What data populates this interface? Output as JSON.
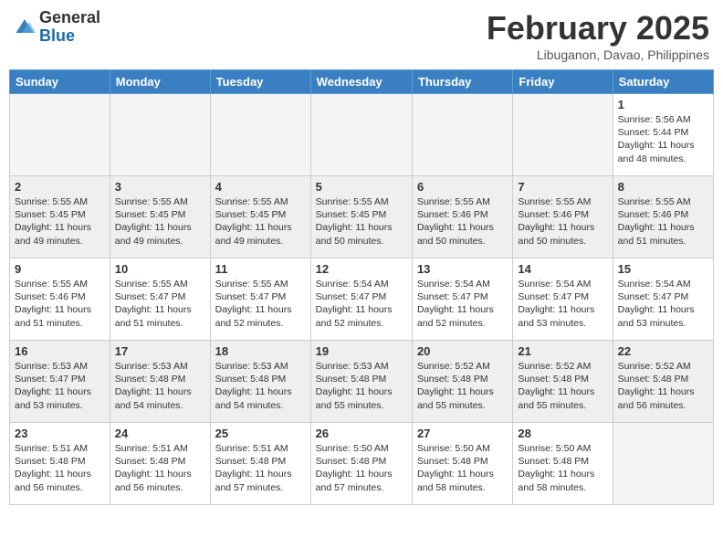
{
  "header": {
    "logo_general": "General",
    "logo_blue": "Blue",
    "month_title": "February 2025",
    "location": "Libuganon, Davao, Philippines"
  },
  "days_of_week": [
    "Sunday",
    "Monday",
    "Tuesday",
    "Wednesday",
    "Thursday",
    "Friday",
    "Saturday"
  ],
  "weeks": [
    {
      "days": [
        {
          "date": "",
          "info": ""
        },
        {
          "date": "",
          "info": ""
        },
        {
          "date": "",
          "info": ""
        },
        {
          "date": "",
          "info": ""
        },
        {
          "date": "",
          "info": ""
        },
        {
          "date": "",
          "info": ""
        },
        {
          "date": "1",
          "info": "Sunrise: 5:56 AM\nSunset: 5:44 PM\nDaylight: 11 hours\nand 48 minutes."
        }
      ]
    },
    {
      "days": [
        {
          "date": "2",
          "info": "Sunrise: 5:55 AM\nSunset: 5:45 PM\nDaylight: 11 hours\nand 49 minutes."
        },
        {
          "date": "3",
          "info": "Sunrise: 5:55 AM\nSunset: 5:45 PM\nDaylight: 11 hours\nand 49 minutes."
        },
        {
          "date": "4",
          "info": "Sunrise: 5:55 AM\nSunset: 5:45 PM\nDaylight: 11 hours\nand 49 minutes."
        },
        {
          "date": "5",
          "info": "Sunrise: 5:55 AM\nSunset: 5:45 PM\nDaylight: 11 hours\nand 50 minutes."
        },
        {
          "date": "6",
          "info": "Sunrise: 5:55 AM\nSunset: 5:46 PM\nDaylight: 11 hours\nand 50 minutes."
        },
        {
          "date": "7",
          "info": "Sunrise: 5:55 AM\nSunset: 5:46 PM\nDaylight: 11 hours\nand 50 minutes."
        },
        {
          "date": "8",
          "info": "Sunrise: 5:55 AM\nSunset: 5:46 PM\nDaylight: 11 hours\nand 51 minutes."
        }
      ]
    },
    {
      "days": [
        {
          "date": "9",
          "info": "Sunrise: 5:55 AM\nSunset: 5:46 PM\nDaylight: 11 hours\nand 51 minutes."
        },
        {
          "date": "10",
          "info": "Sunrise: 5:55 AM\nSunset: 5:47 PM\nDaylight: 11 hours\nand 51 minutes."
        },
        {
          "date": "11",
          "info": "Sunrise: 5:55 AM\nSunset: 5:47 PM\nDaylight: 11 hours\nand 52 minutes."
        },
        {
          "date": "12",
          "info": "Sunrise: 5:54 AM\nSunset: 5:47 PM\nDaylight: 11 hours\nand 52 minutes."
        },
        {
          "date": "13",
          "info": "Sunrise: 5:54 AM\nSunset: 5:47 PM\nDaylight: 11 hours\nand 52 minutes."
        },
        {
          "date": "14",
          "info": "Sunrise: 5:54 AM\nSunset: 5:47 PM\nDaylight: 11 hours\nand 53 minutes."
        },
        {
          "date": "15",
          "info": "Sunrise: 5:54 AM\nSunset: 5:47 PM\nDaylight: 11 hours\nand 53 minutes."
        }
      ]
    },
    {
      "days": [
        {
          "date": "16",
          "info": "Sunrise: 5:53 AM\nSunset: 5:47 PM\nDaylight: 11 hours\nand 53 minutes."
        },
        {
          "date": "17",
          "info": "Sunrise: 5:53 AM\nSunset: 5:48 PM\nDaylight: 11 hours\nand 54 minutes."
        },
        {
          "date": "18",
          "info": "Sunrise: 5:53 AM\nSunset: 5:48 PM\nDaylight: 11 hours\nand 54 minutes."
        },
        {
          "date": "19",
          "info": "Sunrise: 5:53 AM\nSunset: 5:48 PM\nDaylight: 11 hours\nand 55 minutes."
        },
        {
          "date": "20",
          "info": "Sunrise: 5:52 AM\nSunset: 5:48 PM\nDaylight: 11 hours\nand 55 minutes."
        },
        {
          "date": "21",
          "info": "Sunrise: 5:52 AM\nSunset: 5:48 PM\nDaylight: 11 hours\nand 55 minutes."
        },
        {
          "date": "22",
          "info": "Sunrise: 5:52 AM\nSunset: 5:48 PM\nDaylight: 11 hours\nand 56 minutes."
        }
      ]
    },
    {
      "days": [
        {
          "date": "23",
          "info": "Sunrise: 5:51 AM\nSunset: 5:48 PM\nDaylight: 11 hours\nand 56 minutes."
        },
        {
          "date": "24",
          "info": "Sunrise: 5:51 AM\nSunset: 5:48 PM\nDaylight: 11 hours\nand 56 minutes."
        },
        {
          "date": "25",
          "info": "Sunrise: 5:51 AM\nSunset: 5:48 PM\nDaylight: 11 hours\nand 57 minutes."
        },
        {
          "date": "26",
          "info": "Sunrise: 5:50 AM\nSunset: 5:48 PM\nDaylight: 11 hours\nand 57 minutes."
        },
        {
          "date": "27",
          "info": "Sunrise: 5:50 AM\nSunset: 5:48 PM\nDaylight: 11 hours\nand 58 minutes."
        },
        {
          "date": "28",
          "info": "Sunrise: 5:50 AM\nSunset: 5:48 PM\nDaylight: 11 hours\nand 58 minutes."
        },
        {
          "date": "",
          "info": ""
        }
      ]
    }
  ]
}
